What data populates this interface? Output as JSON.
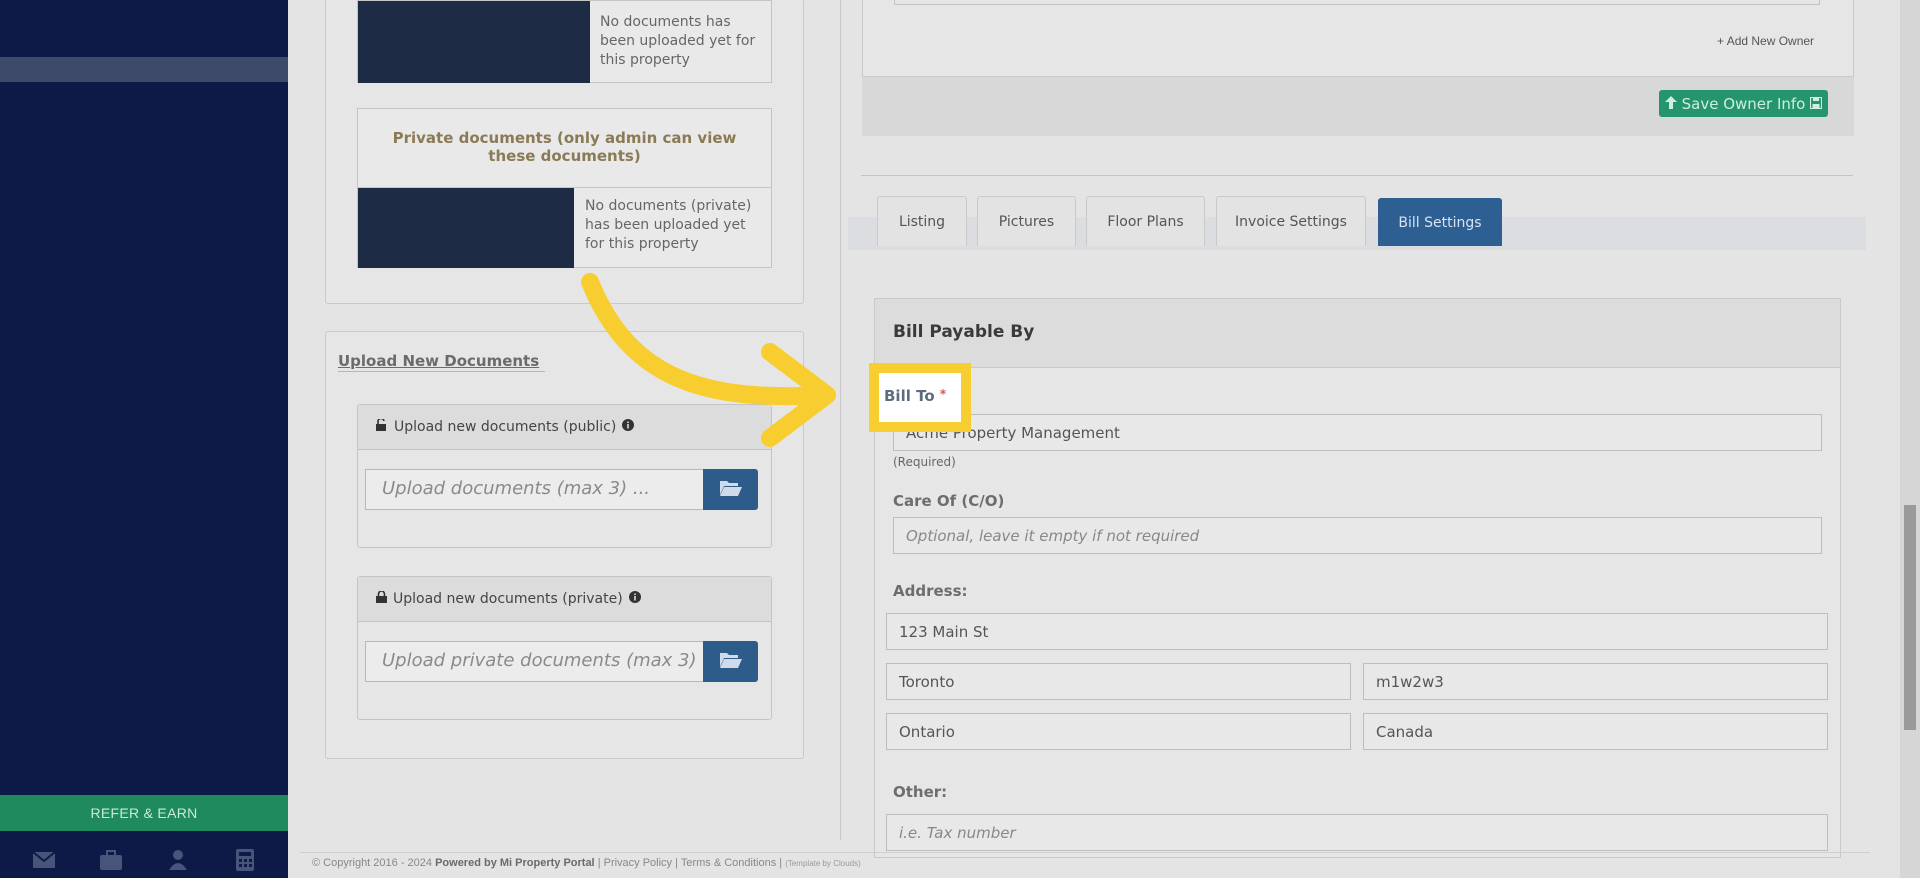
{
  "sidebar": {
    "refer_label": "REFER & EARN",
    "footer_icons": [
      "envelope-icon",
      "briefcase-icon",
      "user-icon",
      "calculator-icon"
    ]
  },
  "documents": {
    "public_empty": "No documents has been uploaded yet for this property",
    "private_title": "Private documents (only admin can view these documents)",
    "private_empty": "No documents (private) has been uploaded yet for this property"
  },
  "upload": {
    "title": "Upload New Documents",
    "public_header": "Upload new documents (public)",
    "public_placeholder": "Upload documents (max 3) ...",
    "private_header": "Upload new documents (private)",
    "private_placeholder": "Upload private documents (max 3) ..."
  },
  "owner": {
    "add_label": "Add New Owner",
    "save_label": "Save Owner Info"
  },
  "tabs": [
    "Listing",
    "Pictures",
    "Floor Plans",
    "Invoice Settings",
    "Bill Settings"
  ],
  "active_tab": "Bill Settings",
  "bill": {
    "title": "Bill Payable By",
    "bill_to_label": "Bill To",
    "required_mark": "*",
    "bill_to_value": "Acme Property Management",
    "required_hint": "(Required)",
    "care_of_label": "Care Of (C/O)",
    "care_of_placeholder": "Optional, leave it empty if not required",
    "address_label": "Address:",
    "street": "123 Main St",
    "city": "Toronto",
    "postal": "m1w2w3",
    "province": "Ontario",
    "country": "Canada",
    "other_label": "Other:",
    "other_placeholder": "i.e. Tax number"
  },
  "footer": {
    "copyright": "© Copyright 2016 - 2024",
    "powered": "Powered by Mi Property Portal",
    "links": "| Privacy Policy | Terms & Conditions |",
    "template": "(Template by Clouds)"
  },
  "colors": {
    "sidebar": "#0d1a47",
    "accent_green": "#24956d",
    "accent_blue": "#2e5f93",
    "highlight": "#f7cd2f"
  }
}
